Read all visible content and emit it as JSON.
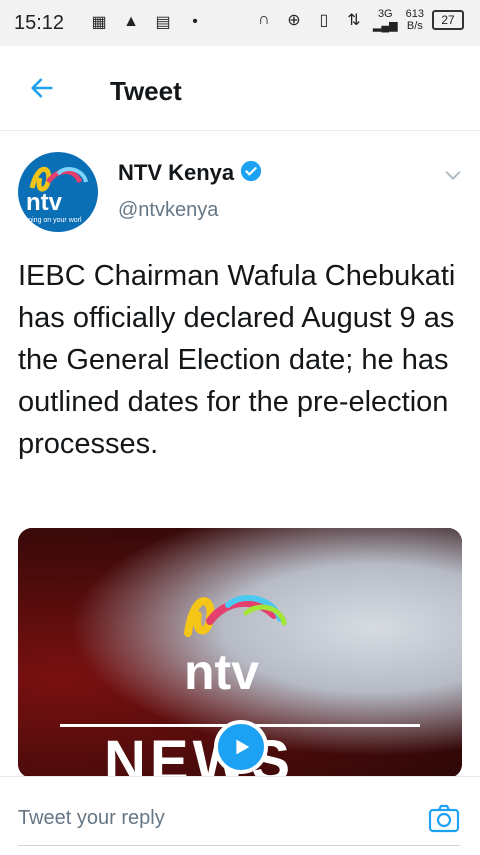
{
  "status_bar": {
    "time": "15:12",
    "network_type": "3G",
    "net_speed_value": "613",
    "net_speed_unit": "B/s",
    "battery": "27"
  },
  "header": {
    "title": "Tweet"
  },
  "tweet": {
    "author_name": "NTV Kenya",
    "author_handle": "@ntvkenya",
    "avatar_text": "ntv",
    "avatar_tagline": "urning on your worl",
    "text": "IEBC Chairman Wafula Chebukati has officially declared August 9 as the General Election date; he has outlined dates for the pre-election processes.",
    "media": {
      "logo_text": "ntv",
      "news_text": "NEWS"
    }
  },
  "reply": {
    "placeholder": "Tweet your reply"
  },
  "colors": {
    "accent": "#1da1f2",
    "text_primary": "#14171a",
    "text_secondary": "#657786"
  },
  "icons": {
    "back": "arrow-left-icon",
    "verified": "verified-badge-icon",
    "chevron": "chevron-down-icon",
    "play": "play-icon",
    "camera": "camera-icon"
  }
}
